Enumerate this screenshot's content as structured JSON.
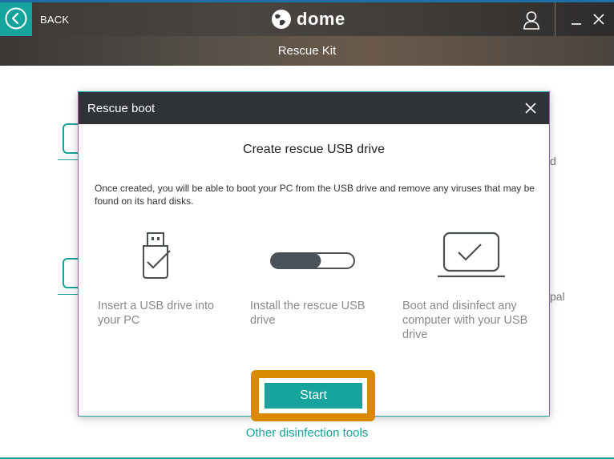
{
  "header": {
    "back_label": "BACK",
    "logo_text": "dome",
    "subtitle": "Rescue Kit"
  },
  "background": {
    "text_right_1": "d",
    "text_right_2": "pal"
  },
  "dialog": {
    "title": "Rescue boot",
    "heading": "Create rescue USB drive",
    "description": "Once created, you will be able to boot your PC from the USB drive and remove any viruses that may be found on its hard disks.",
    "steps": [
      {
        "icon": "usb-drive-check-icon",
        "label": "Insert a USB drive into your PC"
      },
      {
        "icon": "progress-bar-icon",
        "label": "Install the rescue USB drive",
        "progress": 0.6
      },
      {
        "icon": "laptop-check-icon",
        "label": "Boot and disinfect any computer with your USB drive"
      }
    ],
    "start_label": "Start",
    "other_tools_label": "Other disinfection tools"
  },
  "colors": {
    "accent": "#16a39b",
    "highlight": "#d98a00",
    "header_dark": "#2f3337"
  }
}
